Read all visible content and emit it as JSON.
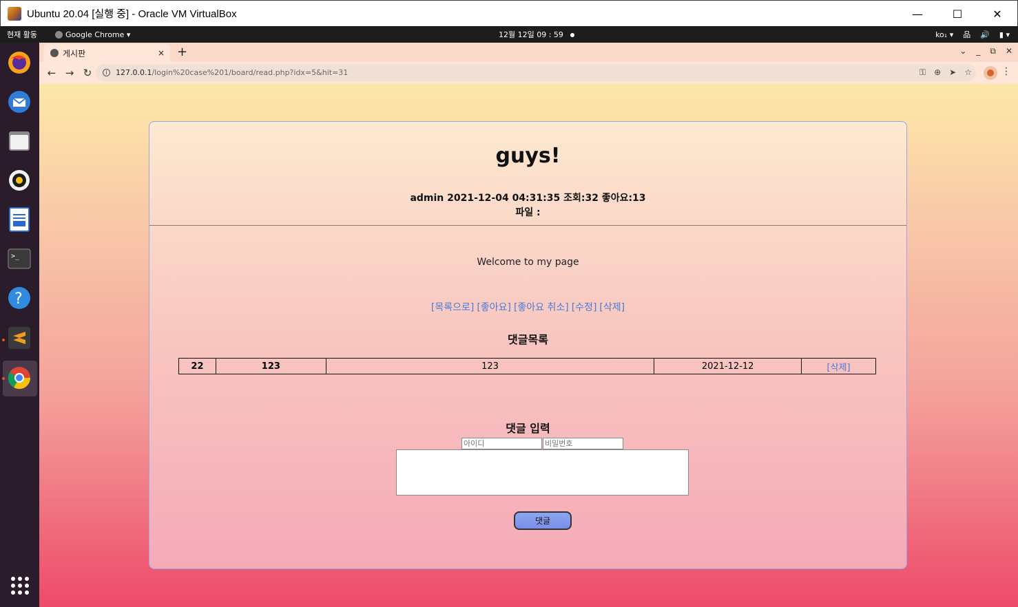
{
  "window": {
    "title": "Ubuntu 20.04 [실행 중] - Oracle VM VirtualBox",
    "minimize": "—",
    "maximize": "☐",
    "close": "✕"
  },
  "ubuntu_panel": {
    "activities": "현재 활동",
    "app_menu": "Google Chrome ▾",
    "clock": "12월 12일  09 : 59",
    "input_method": "ko₁ ▾",
    "tray_network": "品",
    "tray_sound": "🔊",
    "tray_battery": "▮ ▾"
  },
  "dock": {
    "items": [
      "firefox-icon",
      "thunderbird-icon",
      "files-icon",
      "rhythmbox-icon",
      "writer-icon",
      "terminal-icon",
      "help-icon",
      "sublime-icon",
      "chrome-icon"
    ]
  },
  "chrome": {
    "tab_title": "게시판",
    "tab_close": "×",
    "new_tab": "+",
    "tab_menu": "⌄",
    "tab_minimize": "_",
    "tab_restore": "⧉",
    "tab_close_window": "✕",
    "url_host": "127.0.0.1",
    "url_path": "/login%20case%201/board/read.php?idx=5&hit=31",
    "back": "←",
    "forward": "→",
    "reload": "↻",
    "kebab": "⋮"
  },
  "post": {
    "title": "guys!",
    "meta": "admin 2021-12-04 04:31:35 조회:32 좋아요:13",
    "file_label": "파일 :",
    "body": "Welcome to my page",
    "actions": [
      "[목록으로]",
      "[좋아요]",
      "[좋아요 취소]",
      "[수정]",
      "[삭제]"
    ]
  },
  "comments": {
    "heading": "댓글목록",
    "rows": [
      {
        "idx": "22",
        "name": "123",
        "content": "123",
        "date": "2021-12-12",
        "delete": "[삭제]"
      }
    ]
  },
  "comment_form": {
    "heading": "댓글 입력",
    "id_placeholder": "아이디",
    "pw_placeholder": "비밀번호",
    "submit": "댓글"
  },
  "colors": {
    "link": "#4a7ad8",
    "button": "#7b8ee8"
  }
}
